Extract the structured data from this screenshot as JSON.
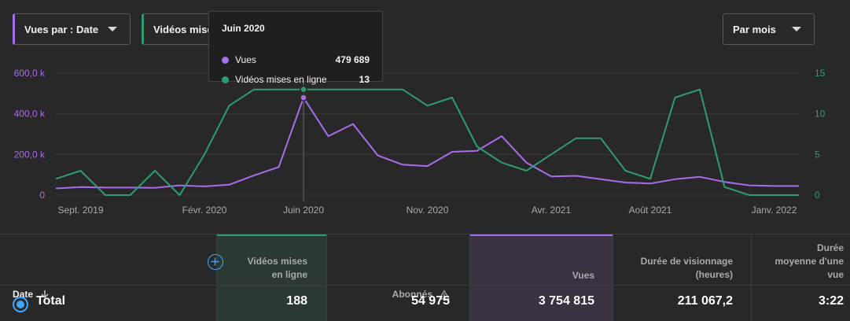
{
  "controls": {
    "metric1_label": "Vues par : Date",
    "metric2_label": "Vidéos mises en ligne",
    "period_label": "Par mois"
  },
  "colors": {
    "views": "#a86dea",
    "uploads": "#2e9c6e",
    "background": "#282828",
    "grid": "#3a3a3a"
  },
  "tooltip": {
    "title": "Juin 2020",
    "rows": [
      {
        "label": "Vues",
        "value": "479 689"
      },
      {
        "label": "Vidéos mises en ligne",
        "value": "13"
      }
    ]
  },
  "chart_data": {
    "type": "line",
    "x": [
      "2019-08",
      "2019-09",
      "2019-10",
      "2019-11",
      "2019-12",
      "2020-01",
      "2020-02",
      "2020-03",
      "2020-04",
      "2020-05",
      "2020-06",
      "2020-07",
      "2020-08",
      "2020-09",
      "2020-10",
      "2020-11",
      "2020-12",
      "2021-01",
      "2021-02",
      "2021-03",
      "2021-04",
      "2021-05",
      "2021-06",
      "2021-07",
      "2021-08",
      "2021-09",
      "2021-10",
      "2021-11",
      "2021-12",
      "2022-01",
      "2022-02"
    ],
    "x_tick_labels": [
      "Sept. 2019",
      "Févr. 2020",
      "Juin 2020",
      "Nov. 2020",
      "Avr. 2021",
      "Août 2021",
      "Janv. 2022"
    ],
    "y_left_ticks": [
      "0",
      "200,0 k",
      "400,0 k",
      "600,0 k"
    ],
    "y_right_ticks": [
      "0",
      "5",
      "10",
      "15"
    ],
    "y_left_lim": [
      0,
      600000
    ],
    "y_right_lim": [
      0,
      15
    ],
    "grid": true,
    "series": [
      {
        "name": "Vues",
        "axis": "left",
        "values": [
          33000,
          40000,
          37000,
          37000,
          36000,
          48000,
          43000,
          51000,
          97000,
          138000,
          479689,
          290000,
          350000,
          195000,
          150000,
          143000,
          213000,
          218000,
          290000,
          160000,
          92000,
          95000,
          78000,
          62000,
          57000,
          78000,
          90000,
          65000,
          48000,
          45000,
          45000
        ]
      },
      {
        "name": "Vidéos mises en ligne",
        "axis": "right",
        "values": [
          2,
          3,
          0,
          0,
          3,
          0,
          5,
          11,
          13,
          13,
          13,
          13,
          13,
          13,
          13,
          11,
          12,
          6,
          4,
          3,
          5,
          7,
          7,
          3,
          2,
          12,
          13,
          1,
          0,
          0,
          0
        ]
      }
    ],
    "highlight_index": 10
  },
  "table": {
    "headers": {
      "date": "Date",
      "uploads_1": "Vidéos mises",
      "uploads_2": "en ligne",
      "subs": "Abonnés",
      "views": "Vues",
      "watch_1": "Durée de visionnage",
      "watch_2": "(heures)",
      "avg_1": "Durée",
      "avg_2": "moyenne d'une",
      "avg_3": "vue"
    },
    "total": {
      "label": "Total",
      "uploads": "188",
      "subs": "54 975",
      "views": "3 754 815",
      "watch": "211 067,2",
      "avg": "3:22"
    }
  }
}
